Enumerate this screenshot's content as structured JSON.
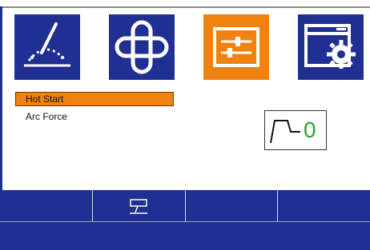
{
  "tiles": [
    {
      "name": "weld-mode-tile",
      "icon": "welding-arc-icon",
      "color": "#1f2f92",
      "selected": false
    },
    {
      "name": "link-tile",
      "icon": "chain-link-icon",
      "color": "#1f2f92",
      "selected": false
    },
    {
      "name": "parameters-tile",
      "icon": "sliders-icon",
      "color": "#f0820f",
      "selected": true
    },
    {
      "name": "settings-tile",
      "icon": "window-gear-icon",
      "color": "#1f2f92",
      "selected": false
    }
  ],
  "menu": {
    "items": [
      {
        "label": "Hot Start",
        "selected": true
      },
      {
        "label": "Arc Force",
        "selected": false
      }
    ]
  },
  "value_display": {
    "icon": "hot-start-waveform-icon",
    "value": "0",
    "value_color": "#2aa23a"
  },
  "softkeys": [
    {
      "icon": ""
    },
    {
      "icon": "screen-flag-icon"
    },
    {
      "icon": ""
    },
    {
      "icon": ""
    }
  ],
  "colors": {
    "accent": "#f0820f",
    "panel": "#1f2f92"
  }
}
